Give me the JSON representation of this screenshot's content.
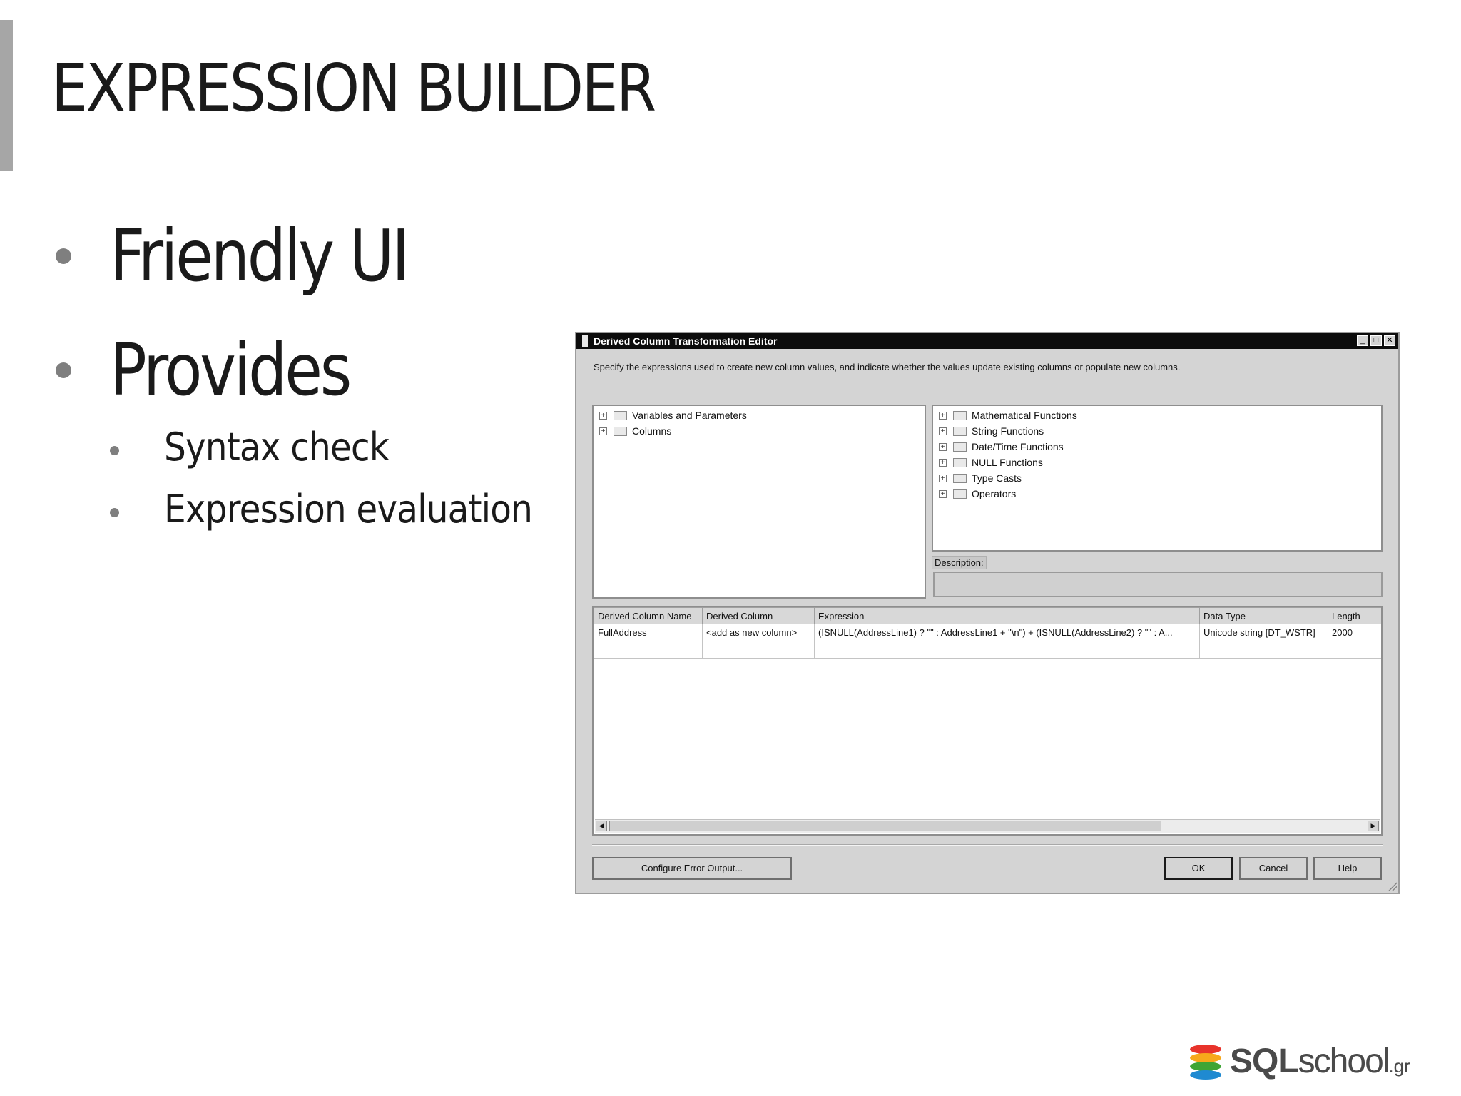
{
  "slide": {
    "title": "EXPRESSION BUILDER",
    "bullets": {
      "friendly_ui": "Friendly UI",
      "provides": "Provides",
      "syntax_check": "Syntax check",
      "expression_evaluation": "Expression evaluation"
    }
  },
  "dialog": {
    "title": "Derived Column Transformation Editor",
    "window_buttons": {
      "minimize": "_",
      "maximize": "□",
      "close": "✕"
    },
    "instructions": "Specify the expressions used to create new column values, and indicate whether the values update existing columns or populate new columns.",
    "left_tree": [
      "Variables and Parameters",
      "Columns"
    ],
    "right_tree": [
      "Mathematical Functions",
      "String Functions",
      "Date/Time Functions",
      "NULL Functions",
      "Type Casts",
      "Operators"
    ],
    "description_label": "Description:",
    "grid": {
      "columns": [
        "Derived Column Name",
        "Derived Column",
        "Expression",
        "Data Type",
        "Length"
      ],
      "rows": [
        [
          "FullAddress",
          "<add as new column>",
          "(ISNULL(AddressLine1) ? \"\" : AddressLine1 + \"\\n\") + (ISNULL(AddressLine2) ? \"\" : A...",
          "Unicode string [DT_WSTR]",
          "2000"
        ]
      ]
    },
    "buttons": {
      "configure_error_output": "Configure Error Output...",
      "ok": "OK",
      "cancel": "Cancel",
      "help": "Help"
    },
    "icons": {
      "expand": "plus-box-icon",
      "folder": "folder-icon"
    }
  },
  "logo": {
    "sql": "SQL",
    "school": "school",
    "suffix": ".gr",
    "colors": [
      "#e8332b",
      "#f7a81b",
      "#3fa535",
      "#1f8ad1"
    ]
  }
}
